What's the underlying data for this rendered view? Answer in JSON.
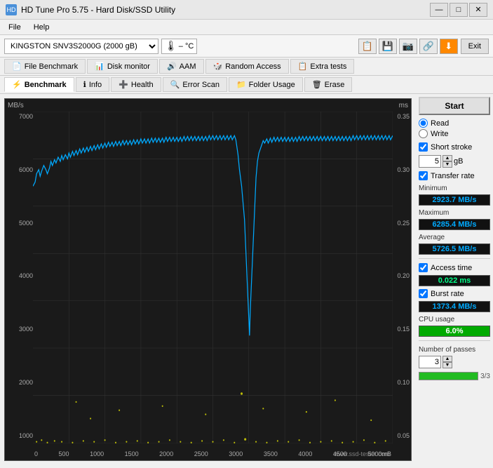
{
  "window": {
    "title": "HD Tune Pro 5.75 - Hard Disk/SSD Utility",
    "controls": [
      "—",
      "□",
      "✕"
    ]
  },
  "menu": {
    "items": [
      "File",
      "Help"
    ]
  },
  "toolbar": {
    "drive_name": "KINGSTON SNV3S2000G (2000 gB)",
    "temperature": "– °C",
    "exit_label": "Exit"
  },
  "tabs_row1": [
    {
      "label": "File Benchmark",
      "icon": "📄",
      "active": false
    },
    {
      "label": "Disk monitor",
      "icon": "📊",
      "active": false
    },
    {
      "label": "AAM",
      "icon": "🔊",
      "active": false
    },
    {
      "label": "Random Access",
      "icon": "🎲",
      "active": false
    },
    {
      "label": "Extra tests",
      "icon": "📋",
      "active": false
    }
  ],
  "tabs_row2": [
    {
      "label": "Benchmark",
      "icon": "⚡",
      "active": true
    },
    {
      "label": "Info",
      "icon": "ℹ",
      "active": false
    },
    {
      "label": "Health",
      "icon": "➕",
      "active": false
    },
    {
      "label": "Error Scan",
      "icon": "🔍",
      "active": false
    },
    {
      "label": "Folder Usage",
      "icon": "📁",
      "active": false
    },
    {
      "label": "Erase",
      "icon": "🗑",
      "active": false
    }
  ],
  "chart": {
    "y_axis_left_label": "MB/s",
    "y_axis_right_label": "ms",
    "y_ticks_left": [
      "7000",
      "6000",
      "5000",
      "4000",
      "3000",
      "2000",
      "1000"
    ],
    "y_ticks_right": [
      "0.35",
      "0.30",
      "0.25",
      "0.20",
      "0.15",
      "0.10",
      "0.05"
    ],
    "x_ticks": [
      "0",
      "500",
      "1000",
      "1500",
      "2000",
      "2500",
      "3000",
      "3500",
      "4000",
      "4500",
      "5000mB"
    ]
  },
  "right_panel": {
    "start_label": "Start",
    "read_label": "Read",
    "write_label": "Write",
    "short_stroke_label": "Short stroke",
    "short_stroke_value": "5",
    "short_stroke_unit": "gB",
    "transfer_rate_label": "Transfer rate",
    "minimum_label": "Minimum",
    "minimum_value": "2923.7 MB/s",
    "maximum_label": "Maximum",
    "maximum_value": "6285.4 MB/s",
    "average_label": "Average",
    "average_value": "5726.5 MB/s",
    "access_time_label": "Access time",
    "access_time_value": "0.022 ms",
    "burst_rate_label": "Burst rate",
    "burst_rate_value": "1373.4 MB/s",
    "cpu_usage_label": "CPU usage",
    "cpu_usage_value": "6.0%",
    "passes_label": "Number of passes",
    "passes_value": "3",
    "progress_label": "3/3",
    "progress_pct": 100
  },
  "watermark": "www.ssd-tester.com"
}
